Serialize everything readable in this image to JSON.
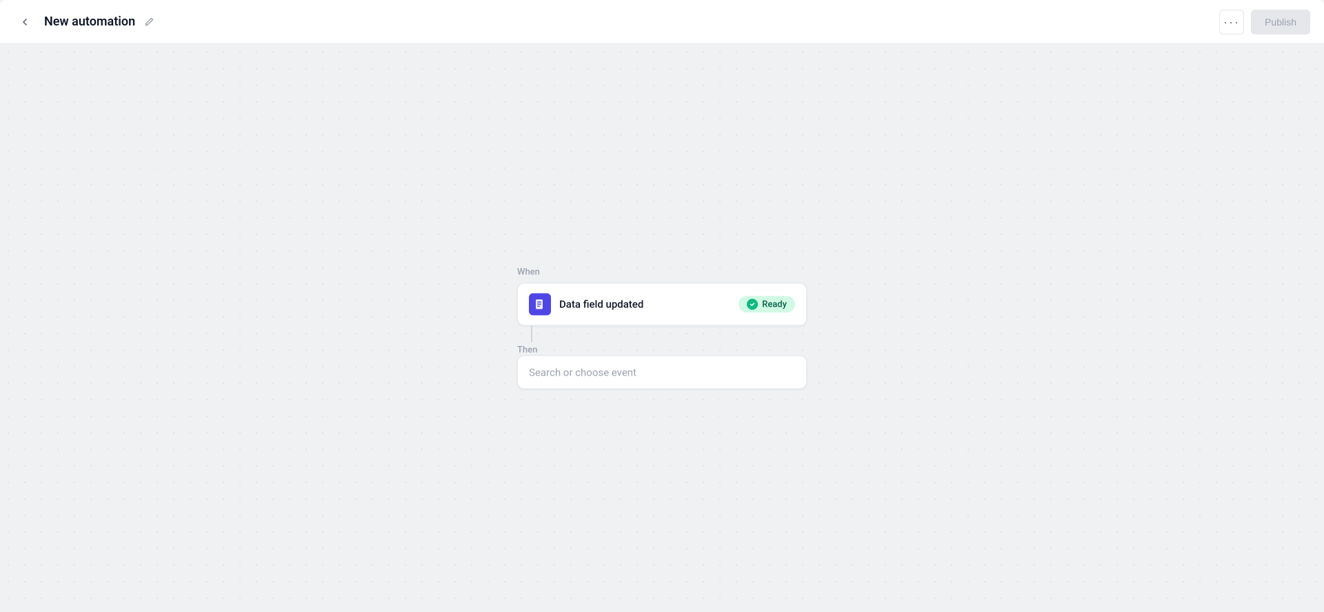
{
  "header": {
    "title": "New automation",
    "edit_icon_label": "edit",
    "more_button_label": "...",
    "publish_button_label": "Publish"
  },
  "flow": {
    "when_label": "When",
    "then_label": "Then",
    "trigger": {
      "name": "Data field updated",
      "icon": "📄",
      "status": "Ready"
    },
    "action": {
      "placeholder": "Search or choose event"
    }
  }
}
